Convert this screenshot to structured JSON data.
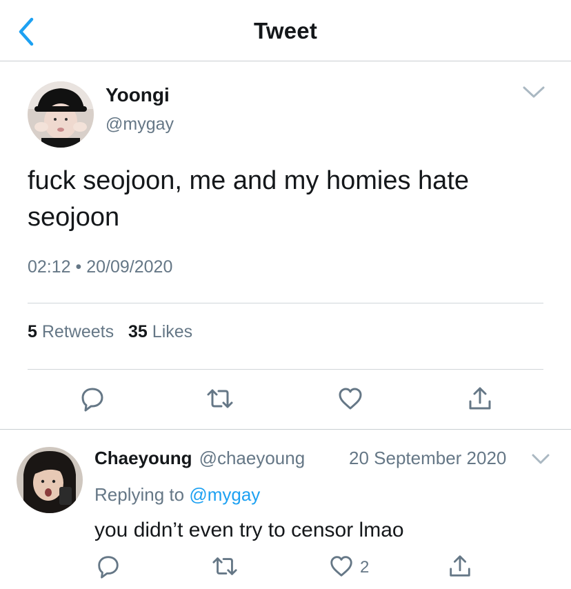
{
  "header": {
    "title": "Tweet",
    "back_icon": "chevron-left-icon"
  },
  "tweet": {
    "author_name": "Yoongi",
    "author_handle": "@mygay",
    "text": "fuck seojoon, me and my homies hate seojoon",
    "time": "02:12",
    "separator": "•",
    "date": "20/09/2020",
    "retweets_count": "5",
    "retweets_label": "Retweets",
    "likes_count": "35",
    "likes_label": "Likes",
    "actions": [
      "reply-icon",
      "retweet-icon",
      "like-icon",
      "share-icon"
    ]
  },
  "reply": {
    "author_name": "Chaeyoung",
    "author_handle": "@chaeyoung",
    "date": "20 September 2020",
    "replying_prefix": "Replying to",
    "replying_handle": "@mygay",
    "text": "you didn’t even try to censor lmao",
    "like_count": "2"
  },
  "colors": {
    "accent": "#1da1f2",
    "secondary_text": "#657786",
    "primary_text": "#14171a",
    "divider": "#c8cdd1"
  }
}
